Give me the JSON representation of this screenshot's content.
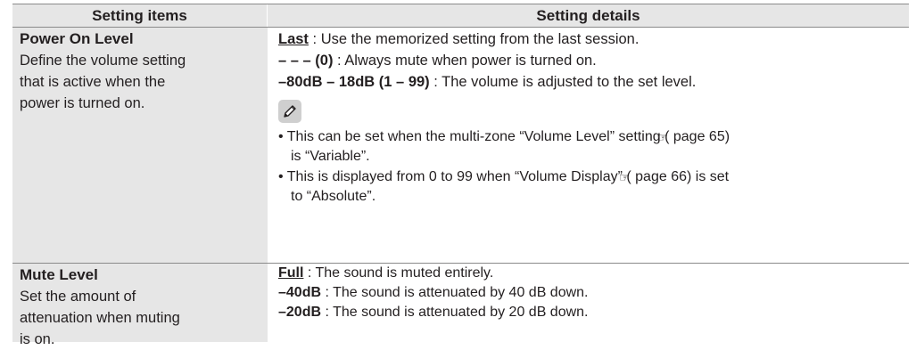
{
  "header": {
    "col1": "Setting items",
    "col2": "Setting details"
  },
  "rows": [
    {
      "title": "Power On Level",
      "desc_lines": [
        "Define the volume setting",
        "that is active when the",
        "power is turned on."
      ],
      "options": [
        {
          "key": "Last",
          "text": " : Use the memorized setting from the last session."
        },
        {
          "key": "– – – (0)",
          "text": " : Always mute when power is turned on."
        },
        {
          "key": "–80dB – 18dB (1 – 99)",
          "text": " : The volume is adjusted to the set level."
        }
      ],
      "notes": [
        {
          "pre": "This can be set when the multi-zone “Volume Level” setting (",
          "ref_icon": "page-reference-icon",
          "page": "page 65)",
          "post": "is “Variable”."
        },
        {
          "pre": "This is displayed from 0 to 99 when “Volume Display” (",
          "ref_icon": "page-reference-icon",
          "page": "page 66) is set",
          "post": "to “Absolute”."
        }
      ]
    },
    {
      "title": "Mute Level",
      "desc_lines": [
        "Set the amount of",
        "attenuation when muting",
        "is on."
      ],
      "options": [
        {
          "key": "Full",
          "text": " : The sound is muted entirely."
        },
        {
          "key": "–40dB",
          "text": " : The sound is attenuated by 40 dB down."
        },
        {
          "key": "–20dB",
          "text": " : The sound is attenuated by 20 dB down."
        }
      ]
    }
  ],
  "icons": {
    "note": "pencil-icon",
    "reference": "page-reference-icon"
  }
}
